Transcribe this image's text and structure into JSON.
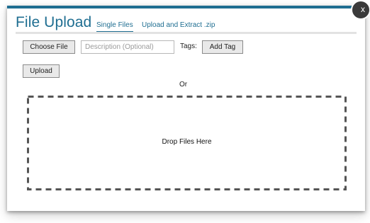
{
  "dialog": {
    "title": "File Upload",
    "close_glyph": "x",
    "tabs": [
      {
        "label": "Single Files",
        "active": true
      },
      {
        "label": "Upload and Extract .zip",
        "active": false
      }
    ]
  },
  "form": {
    "choose_file_label": "Choose File",
    "description_placeholder": "Description (Optional)",
    "tags_label": "Tags:",
    "add_tag_label": "Add Tag",
    "upload_label": "Upload"
  },
  "divider_text": "Or",
  "drop_zone": {
    "label": "Drop Files Here"
  },
  "colors": {
    "accent": "#1f6e91",
    "close_button": "#3a3a3a",
    "drop_border": "#555555"
  },
  "icons": {
    "close": "close-icon"
  }
}
